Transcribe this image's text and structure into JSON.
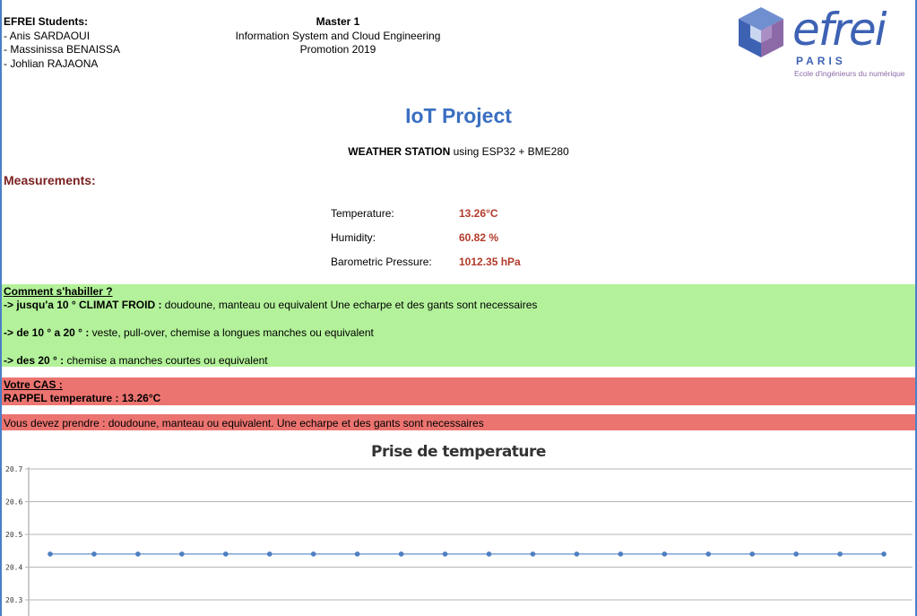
{
  "header": {
    "students_title": "EFREI Students:",
    "students": [
      "- Anis SARDAOUI",
      "- Massinissa BENAISSA",
      "- Johlian RAJAONA"
    ],
    "master_title": "Master 1",
    "program": "Information System and Cloud Engineering",
    "promotion": "Promotion 2019"
  },
  "logo": {
    "word": "efrei",
    "city": "PARIS",
    "tagline": "Ecole d'ingénieurs du numérique",
    "colors": {
      "blue": "#3d62b4",
      "violet": "#8c6aa8"
    }
  },
  "title": "IoT Project",
  "subtitle": {
    "bold": "WEATHER STATION",
    "rest": " using ESP32 + BME280"
  },
  "measurements": {
    "heading": "Measurements:",
    "rows": [
      {
        "label": "Temperature:",
        "value": "13.26°C"
      },
      {
        "label": "Humidity:",
        "value": "60.82 %"
      },
      {
        "label": "Barometric Pressure:",
        "value": "1012.35 hPa"
      }
    ]
  },
  "advice": {
    "heading": "Comment s'habiller ?",
    "items": [
      {
        "bold": "-> jusqu'a 10 ° CLIMAT FROID :",
        "text": " doudoune, manteau ou equivalent Une echarpe et des gants sont necessaires"
      },
      {
        "bold": "-> de 10 ° a 20 ° :",
        "text": " veste, pull-over, chemise a longues manches ou equivalent"
      },
      {
        "bold": "-> des 20 ° :",
        "text": " chemise a manches courtes ou equivalent"
      }
    ],
    "color": "#b3f29a"
  },
  "case": {
    "heading": "Votre CAS :",
    "reminder": "RAPPEL temperature : 13.26°C",
    "recommendation": "Vous devez prendre : doudoune, manteau ou equivalent. Une echarpe et des gants sont necessaires",
    "color": "#ec7470"
  },
  "chart_data": {
    "type": "line",
    "title": "Prise de temperature",
    "xlabel": "",
    "ylabel": "",
    "yticks": [
      "20.7",
      "20.6",
      "20.5",
      "20.4",
      "20.3"
    ],
    "ylim": [
      20.3,
      20.7
    ],
    "grid": true,
    "series": [
      {
        "values": [
          20.44,
          20.44,
          20.44,
          20.44,
          20.44,
          20.44,
          20.44,
          20.44,
          20.44,
          20.44,
          20.44,
          20.44,
          20.44,
          20.44,
          20.44,
          20.44,
          20.44,
          20.44,
          20.44,
          20.44
        ]
      }
    ],
    "line_color": "#7aa3d6",
    "marker_color": "#4d7fc0"
  }
}
